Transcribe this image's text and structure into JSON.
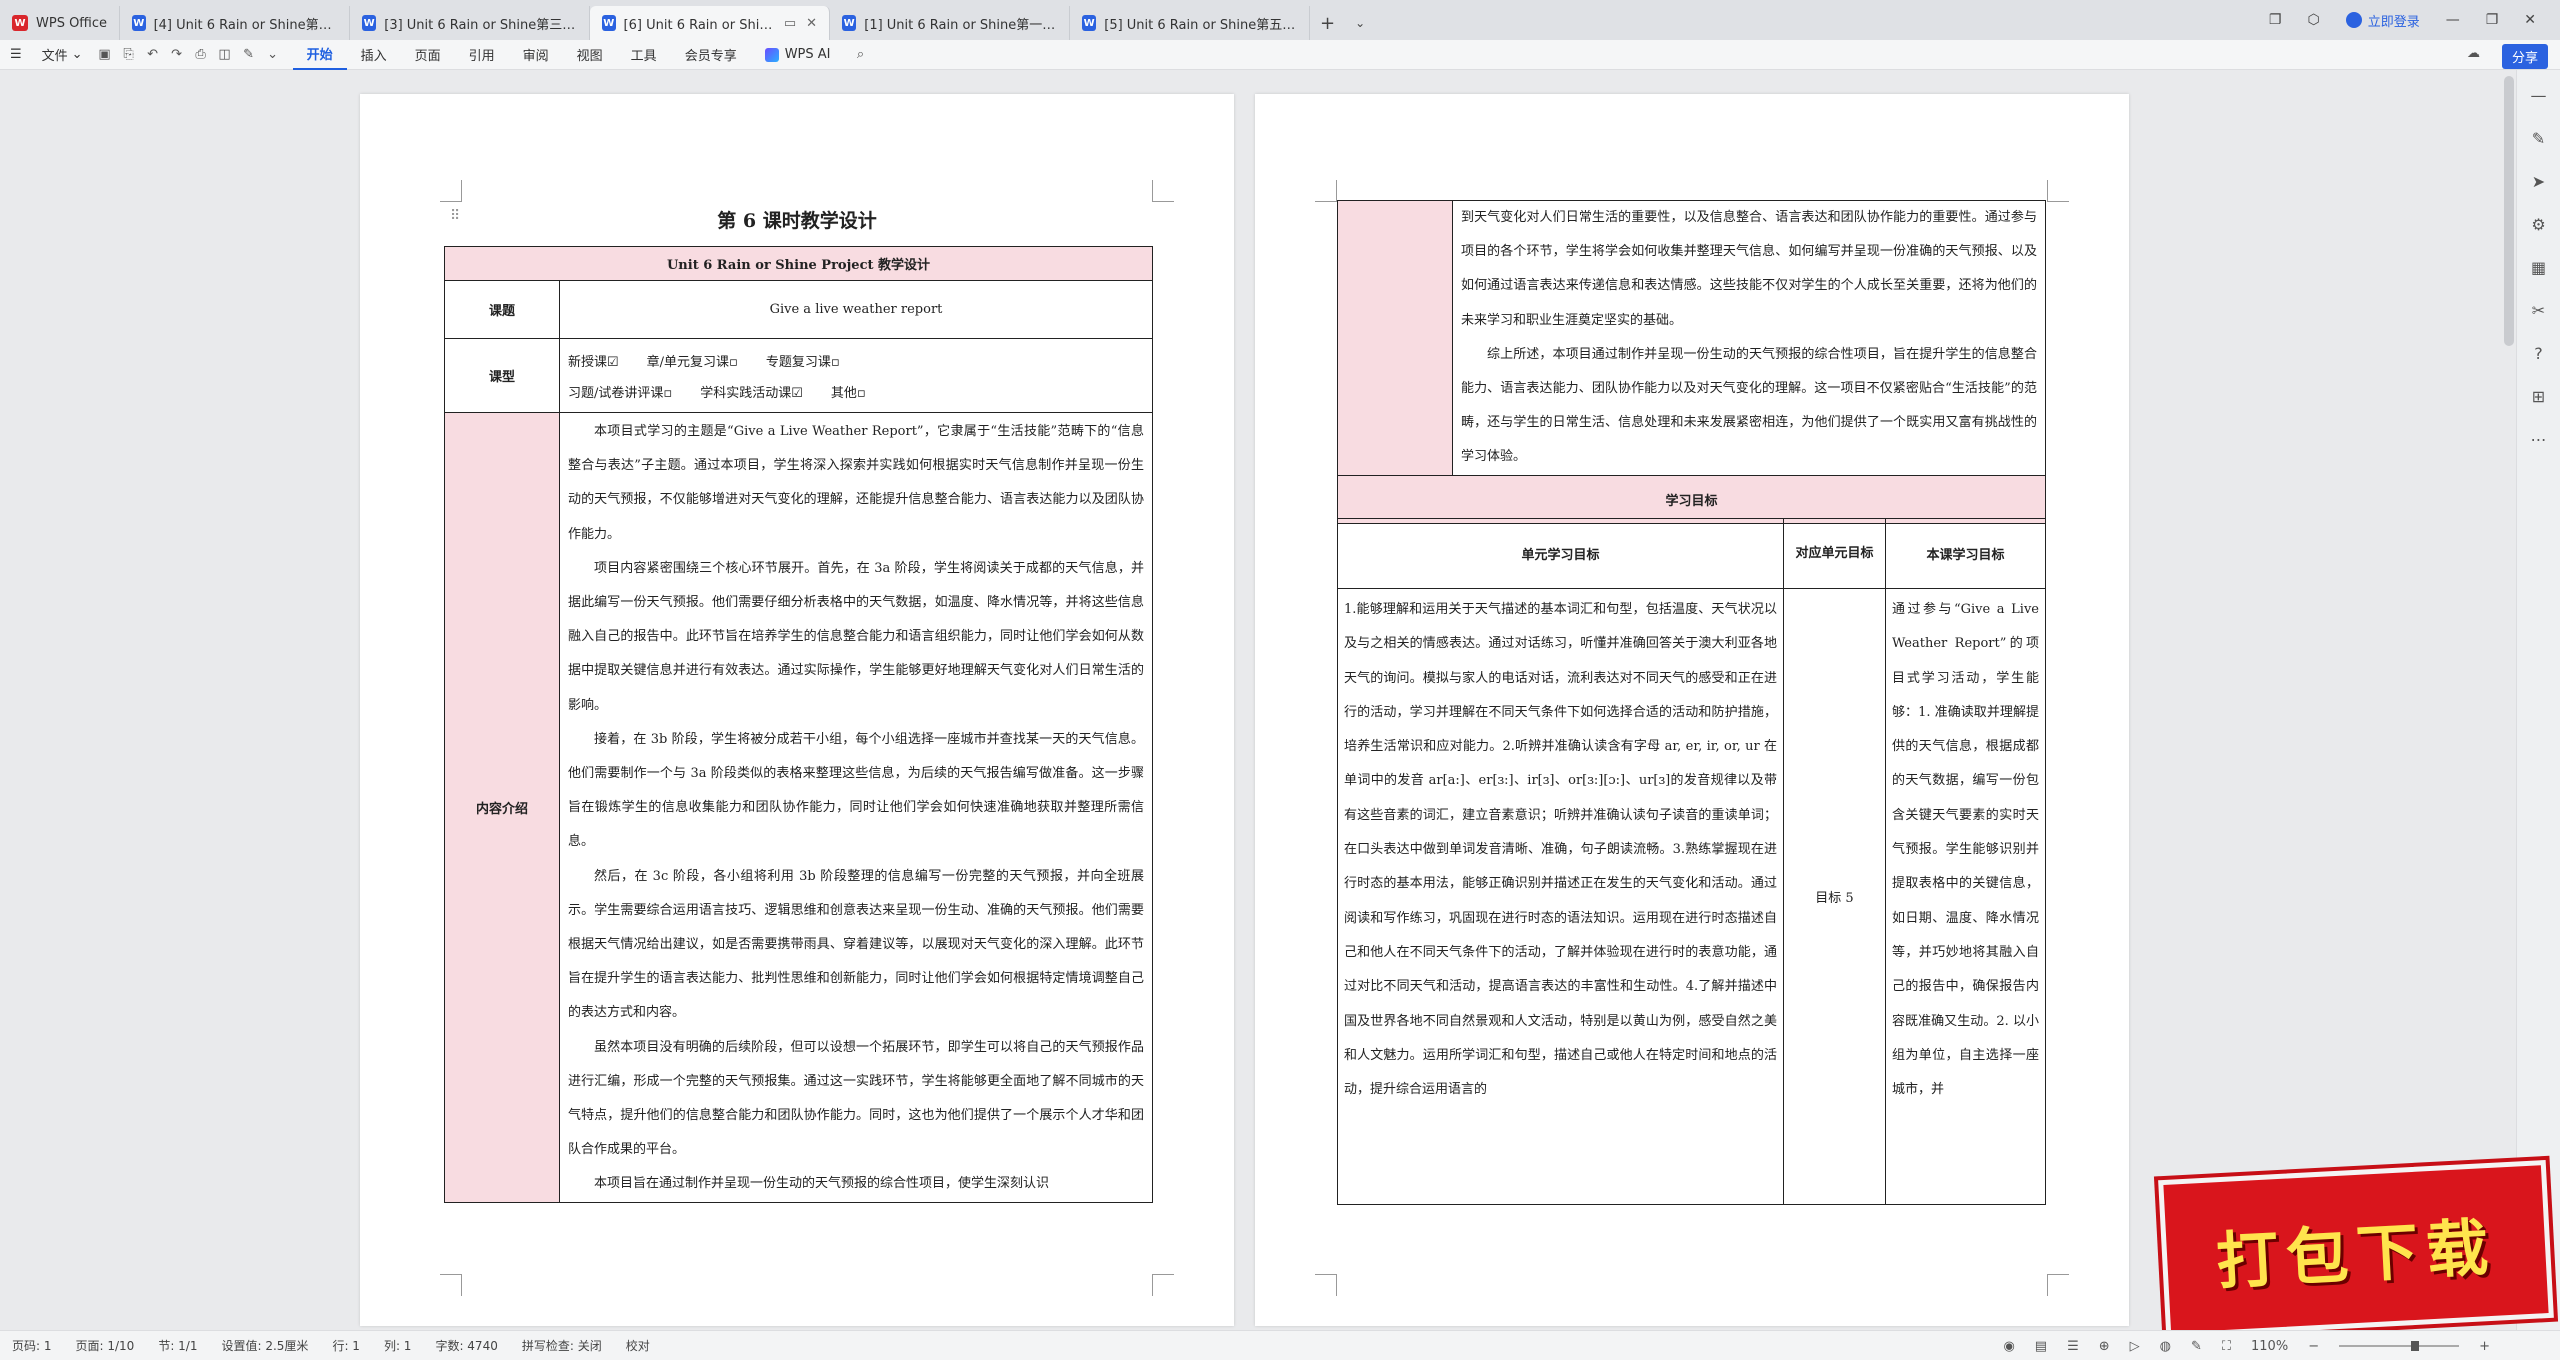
{
  "tabs": [
    {
      "label": "WPS Office",
      "icon": "wps-logo-icon",
      "active": false
    },
    {
      "label": "[4] Unit 6 Rain or Shine第四课时…",
      "icon": "word-doc-icon",
      "active": false
    },
    {
      "label": "[3] Unit 6 Rain or Shine第三课时…",
      "icon": "word-doc-icon",
      "active": false
    },
    {
      "label": "[6] Unit 6 Rain or Shine第…",
      "icon": "word-doc-icon",
      "active": true
    },
    {
      "label": "[1] Unit 6 Rain or Shine第一课时…",
      "icon": "word-doc-icon",
      "active": false
    },
    {
      "label": "[5] Unit 6 Rain or Shine第五课时…",
      "icon": "word-doc-icon",
      "active": false
    }
  ],
  "titlebar": {
    "login": "立即登录"
  },
  "ribbon": {
    "file": "文件",
    "menus": [
      "开始",
      "插入",
      "页面",
      "引用",
      "审阅",
      "视图",
      "工具",
      "会员专享"
    ],
    "active_menu": "开始",
    "wps_ai": "WPS AI",
    "share": "分享"
  },
  "page1": {
    "title": "第 6 课时教学设计",
    "table_header": "Unit 6 Rain or Shine    Project 教学设计",
    "topic_label": "课题",
    "topic_value": "Give a live weather report",
    "type_label": "课型",
    "type_row1": [
      "新授课☑",
      "章/单元复习课▫",
      "专题复习课▫"
    ],
    "type_row2": [
      "习题/试卷讲评课▫",
      "学科实践活动课☑",
      "其他▫"
    ],
    "intro_label": "内容介绍",
    "intro_paragraphs": [
      "本项目式学习的主题是“Give a Live Weather Report”，它隶属于“生活技能”范畴下的“信息整合与表达”子主题。通过本项目，学生将深入探索并实践如何根据实时天气信息制作并呈现一份生动的天气预报，不仅能够增进对天气变化的理解，还能提升信息整合能力、语言表达能力以及团队协作能力。",
      "项目内容紧密围绕三个核心环节展开。首先，在 3a 阶段，学生将阅读关于成都的天气信息，并据此编写一份天气预报。他们需要仔细分析表格中的天气数据，如温度、降水情况等，并将这些信息融入自己的报告中。此环节旨在培养学生的信息整合能力和语言组织能力，同时让他们学会如何从数据中提取关键信息并进行有效表达。通过实际操作，学生能够更好地理解天气变化对人们日常生活的影响。",
      "接着，在 3b 阶段，学生将被分成若干小组，每个小组选择一座城市并查找某一天的天气信息。他们需要制作一个与 3a 阶段类似的表格来整理这些信息，为后续的天气报告编写做准备。这一步骤旨在锻炼学生的信息收集能力和团队协作能力，同时让他们学会如何快速准确地获取并整理所需信息。",
      "然后，在 3c 阶段，各小组将利用 3b 阶段整理的信息编写一份完整的天气预报，并向全班展示。学生需要综合运用语言技巧、逻辑思维和创意表达来呈现一份生动、准确的天气预报。他们需要根据天气情况给出建议，如是否需要携带雨具、穿着建议等，以展现对天气变化的深入理解。此环节旨在提升学生的语言表达能力、批判性思维和创新能力，同时让他们学会如何根据特定情境调整自己的表达方式和内容。",
      "虽然本项目没有明确的后续阶段，但可以设想一个拓展环节，即学生可以将自己的天气预报作品进行汇编，形成一个完整的天气预报集。通过这一实践环节，学生将能够更全面地了解不同城市的天气特点，提升他们的信息整合能力和团队协作能力。同时，这也为他们提供了一个展示个人才华和团队合作成果的平台。",
      "本项目旨在通过制作并呈现一份生动的天气预报的综合性项目，使学生深刻认识"
    ]
  },
  "page2": {
    "cont_paragraphs": [
      "到天气变化对人们日常生活的重要性，以及信息整合、语言表达和团队协作能力的重要性。通过参与项目的各个环节，学生将学会如何收集并整理天气信息、如何编写并呈现一份准确的天气预报、以及如何通过语言表达来传递信息和表达情感。这些技能不仅对学生的个人成长至关重要，还将为他们的未来学习和职业生涯奠定坚实的基础。",
      "综上所述，本项目通过制作并呈现一份生动的天气预报的综合性项目，旨在提升学生的信息整合能力、语言表达能力、团队协作能力以及对天气变化的理解。这一项目不仅紧密贴合“生活技能”的范畴，还与学生的日常生活、信息处理和未来发展紧密相连，为他们提供了一个既实用又富有挑战性的学习体验。"
    ],
    "goals_header": "学习目标",
    "col_unit": "单元学习目标",
    "col_match": "对应单元目标",
    "col_lesson": "本课学习目标",
    "unit_goals": "1.能够理解和运用关于天气描述的基本词汇和句型，包括温度、天气状况以及与之相关的情感表达。通过对话练习，听懂并准确回答关于澳大利亚各地天气的询问。模拟与家人的电话对话，流利表达对不同天气的感受和正在进行的活动，学习并理解在不同天气条件下如何选择合适的活动和防护措施，培养生活常识和应对能力。2.听辨并准确认读含有字母 ar, er, ir, or, ur 在单词中的发音 ar[a:]、er[ɜ:]、ir[ɜ]、or[ɜ:][ɔ:]、ur[ɜ]的发音规律以及带有这些音素的词汇，建立音素意识；听辨并准确认读句子读音的重读单词；在口头表达中做到单词发音清晰、准确，句子朗读流畅。3.熟练掌握现在进行时态的基本用法，能够正确识别并描述正在发生的天气变化和活动。通过阅读和写作练习，巩固现在进行时态的语法知识。运用现在进行时态描述自己和他人在不同天气条件下的活动，了解并体验现在进行时的表意功能，通过对比不同天气和活动，提高语言表达的丰富性和生动性。4.了解并描述中国及世界各地不同自然景观和人文活动，特别是以黄山为例，感受自然之美和人文魅力。运用所学词汇和句型，描述自己或他人在特定时间和地点的活动，提升综合运用语言的",
    "match_value": "目标 5",
    "lesson_goals": "通过参与“Give a Live Weather Report”的项目式学习活动，学生能够：1. 准确读取并理解提供的天气信息，根据成都的天气数据，编写一份包含关键天气要素的实时天气预报。学生能够识别并提取表格中的关键信息，如日期、温度、降水情况等，并巧妙地将其融入自己的报告中，确保报告内容既准确又生动。2. 以小组为单位，自主选择一座城市，并"
  },
  "statusbar": {
    "page_code": "页码: 1",
    "page_count": "页面: 1/10",
    "section": "节: 1/1",
    "setting": "设置值: 2.5厘米",
    "row": "行: 1",
    "col": "列: 1",
    "words": "字数: 4740",
    "spell": "拼写检查: 关闭",
    "proof": "校对",
    "zoom": "110%"
  },
  "badge": {
    "text": "打包下载"
  },
  "colors": {
    "accent": "#1f5fe0",
    "table_pink": "#f8dce1",
    "badge_red": "#d9151c",
    "badge_text": "#ffe44d"
  }
}
